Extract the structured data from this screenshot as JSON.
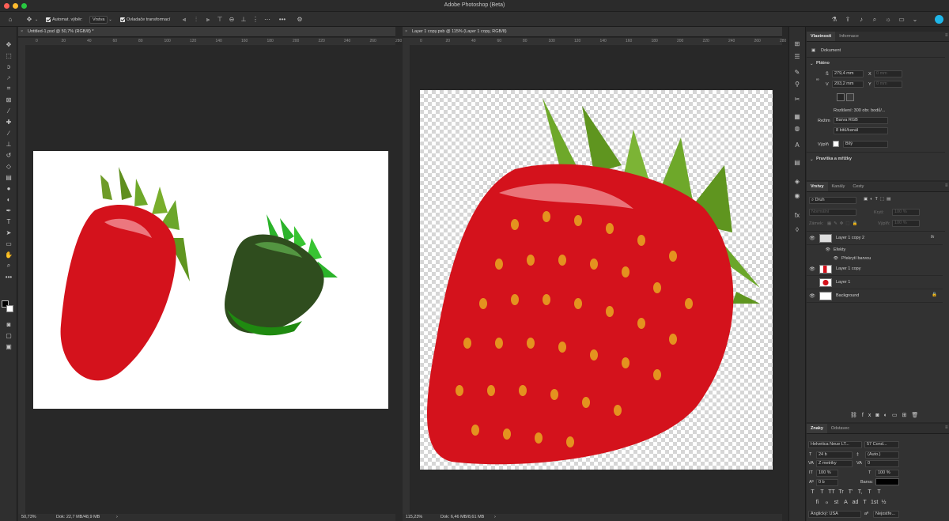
{
  "app": {
    "title": "Adobe Photoshop (Beta)"
  },
  "options_bar": {
    "auto_select_label": "Automat. výběr:",
    "auto_select_value": "Vrstva",
    "transform_label": "Ovladače transformací",
    "more": "•••"
  },
  "documents": [
    {
      "tab": "Untitled-1.psd @ 50,7% (RGB/8) *",
      "zoom": "50,73%",
      "status": "Dok: 22,7 MB/48,9 MB",
      "ruler": [
        "0",
        "20",
        "40",
        "60",
        "80",
        "100",
        "120",
        "140",
        "160",
        "180",
        "200",
        "220",
        "240",
        "260",
        "280"
      ]
    },
    {
      "tab": "Layer 1 copy.psb @ 115% (Layer 1 copy, RGB/8)",
      "zoom": "115,23%",
      "status": "Dok: 6,46 MB/8,61 MB",
      "ruler": [
        "0",
        "20",
        "40",
        "60",
        "80",
        "100",
        "120",
        "140",
        "160",
        "180",
        "200",
        "220",
        "240",
        "260",
        "280"
      ]
    }
  ],
  "properties": {
    "tabs": [
      "Vlastnosti",
      "Informace"
    ],
    "doc_label": "Dokument",
    "section_canvas": "Plátno",
    "width_label": "Š",
    "width_value": "279,4 mm",
    "height_label": "V",
    "height_value": "203,2 mm",
    "x_label": "X",
    "x_value": "0 mm",
    "y_label": "Y",
    "y_value": "0 mm",
    "resolution": "Rozlišení: 300 obr. bodů/...",
    "mode_label": "Režim",
    "mode_value": "Barva RGB",
    "depth_value": "8 bitů/kanál",
    "fill_label": "Výplň",
    "fill_value": "Bílý",
    "section_rulers": "Pravítka a mřížky"
  },
  "layers_panel": {
    "tabs": [
      "Vrstvy",
      "Kanály",
      "Cesty"
    ],
    "kind_value": "Druh",
    "blend_value": "Normální",
    "opacity_label": "Krytí:",
    "opacity_value": "100 %",
    "lock_label": "Zámek:",
    "fill_label": "Výplň:",
    "fill_value": "100 %",
    "layers": [
      {
        "name": "Layer 1 copy 2",
        "visible": true,
        "fx": "fx"
      },
      {
        "name": "Efekty",
        "visible": true
      },
      {
        "name": "Překrytí barvou",
        "visible": true
      },
      {
        "name": "Layer 1 copy",
        "visible": true
      },
      {
        "name": "Layer 1",
        "visible": false
      },
      {
        "name": "Background",
        "visible": true
      }
    ]
  },
  "character": {
    "tabs": [
      "Znaky",
      "Odstavec"
    ],
    "font_family": "Helvetica Neue LT...",
    "font_style": "57 Cond...",
    "size": "24 b",
    "leading": "(Auto.)",
    "kerning": "Z metriky",
    "tracking": "0",
    "v_scale": "100 %",
    "h_scale": "100 %",
    "baseline": "0 b",
    "color_label": "Barva:",
    "style_buttons": [
      "T",
      "T",
      "TT",
      "Tr",
      "T'",
      "T,",
      "T",
      "T"
    ],
    "opentype_buttons": [
      "fi",
      "ℴ",
      "st",
      "A",
      "ad",
      "T",
      "1st",
      "½"
    ],
    "language": "Anglický: USA",
    "anti_alias": "Nejostře..."
  },
  "colors": {
    "accent": "#1473e6",
    "strawberry": "#d4121c",
    "leaf": "#5a9a1e",
    "green_berry": "#1f8a10"
  }
}
